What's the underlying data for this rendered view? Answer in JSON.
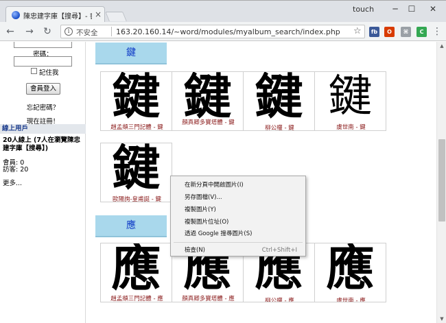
{
  "browser": {
    "tab_title": "陳忠建字庫【搜尋】- 書",
    "tab_close": "×",
    "profile_name": "touch",
    "win_min": "─",
    "win_max": "☐",
    "win_close": "✕",
    "back": "←",
    "forward": "→",
    "reload": "↻",
    "security_label": "不安全",
    "url": "163.20.160.14/~word/modules/myalbum_search/index.php",
    "star": "☆",
    "extensions": [
      {
        "label": "fb",
        "color": "#3b5998"
      },
      {
        "label": "O",
        "color": "#d83b01"
      },
      {
        "label": "⌘",
        "color": "#9aa0a6"
      },
      {
        "label": "C",
        "color": "#34a853"
      },
      {
        "label": "◉",
        "color": "#7b5cd6"
      }
    ],
    "menu": "⋮"
  },
  "sidebar": {
    "password_label": "密碼：",
    "remember_label": "記住我",
    "login_button": "會員登入",
    "forgot_password": "忘記密碼？",
    "register": "現在註冊！",
    "online_header": "線上用戶",
    "online_text": "20人線上 (7人在瀏覽陳忠建字庫【搜尋】)",
    "members": "會員: 0",
    "guests": "訪客: 20",
    "more": "更多..."
  },
  "sections": [
    {
      "title": "鍵",
      "items": [
        {
          "glyph": "鍵",
          "caption": "趙孟頫三門記體 - 鍵"
        },
        {
          "glyph": "鍵",
          "caption": "顏真卿多寶塔體 - 鍵"
        },
        {
          "glyph": "鍵",
          "caption": "柳公權 - 鍵"
        },
        {
          "glyph": "鍵",
          "caption": "虞世南 - 鍵"
        },
        {
          "glyph": "鍵",
          "caption": "歐陽詢-皇甫誕 - 鍵"
        }
      ]
    },
    {
      "title": "應",
      "items": [
        {
          "glyph": "應",
          "caption": "趙孟頫三門記體 - 應"
        },
        {
          "glyph": "應",
          "caption": "顏真卿多寶塔體 - 應"
        },
        {
          "glyph": "應",
          "caption": "柳公權 - 應"
        },
        {
          "glyph": "應",
          "caption": "虞世南 - 應"
        }
      ]
    }
  ],
  "context_menu": {
    "items": [
      {
        "label": "在新分頁中開啟圖片(I)"
      },
      {
        "label": "另存圖檔(V)..."
      },
      {
        "label": "複製圖片(Y)"
      },
      {
        "label": "複製圖片位址(O)"
      },
      {
        "label": "透過 Google 搜尋圖片(S)"
      }
    ],
    "inspect_label": "檢查(N)",
    "inspect_shortcut": "Ctrl+Shift+I"
  }
}
